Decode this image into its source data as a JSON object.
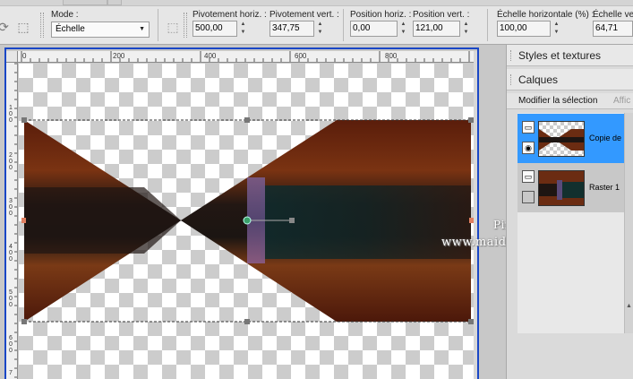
{
  "toolbar": {
    "mode": {
      "label": "Mode :",
      "value": "Échelle"
    },
    "fields": [
      {
        "label": "Pivotement horiz. :",
        "value": "500,00"
      },
      {
        "label": "Pivotement vert. :",
        "value": "347,75"
      },
      {
        "label": "Position horiz. :",
        "value": "0,00"
      },
      {
        "label": "Position vert. :",
        "value": "121,00"
      },
      {
        "label": "Échelle horizontale (%) :",
        "value": "100,00"
      },
      {
        "label": "Échelle vert",
        "value": "64,71"
      }
    ]
  },
  "ruler": {
    "top_labels": [
      "0",
      "200",
      "400",
      "600",
      "800"
    ],
    "left_labels": [
      "1",
      "0",
      "0",
      "2",
      "0",
      "0",
      "3",
      "0",
      "0",
      "4",
      "0",
      "0",
      "5",
      "0",
      "0",
      "6",
      "0",
      "0",
      "7",
      "0",
      "0"
    ]
  },
  "panels": {
    "styles_title": "Styles et textures",
    "layers_title": "Calques",
    "toolbar": {
      "modify_selection": "Modifier la sélection",
      "display": "Affic"
    },
    "layers": [
      {
        "name": "Copie de R",
        "selected": true
      },
      {
        "name": "Raster 1",
        "selected": false
      }
    ]
  },
  "watermark": {
    "line1": "Pinuccia",
    "line2": "www.maidiregrafica.eu"
  },
  "colors": {
    "selection_blue": "#3399ff",
    "window_border": "#1a47c6",
    "image_brown": "#6b2c12",
    "image_dark": "#1e1512"
  },
  "icons": [
    "rotate-icon",
    "deform-icon",
    "eye-icon",
    "layer-icon",
    "spinner-arrow-icon",
    "chevron-down-icon"
  ]
}
